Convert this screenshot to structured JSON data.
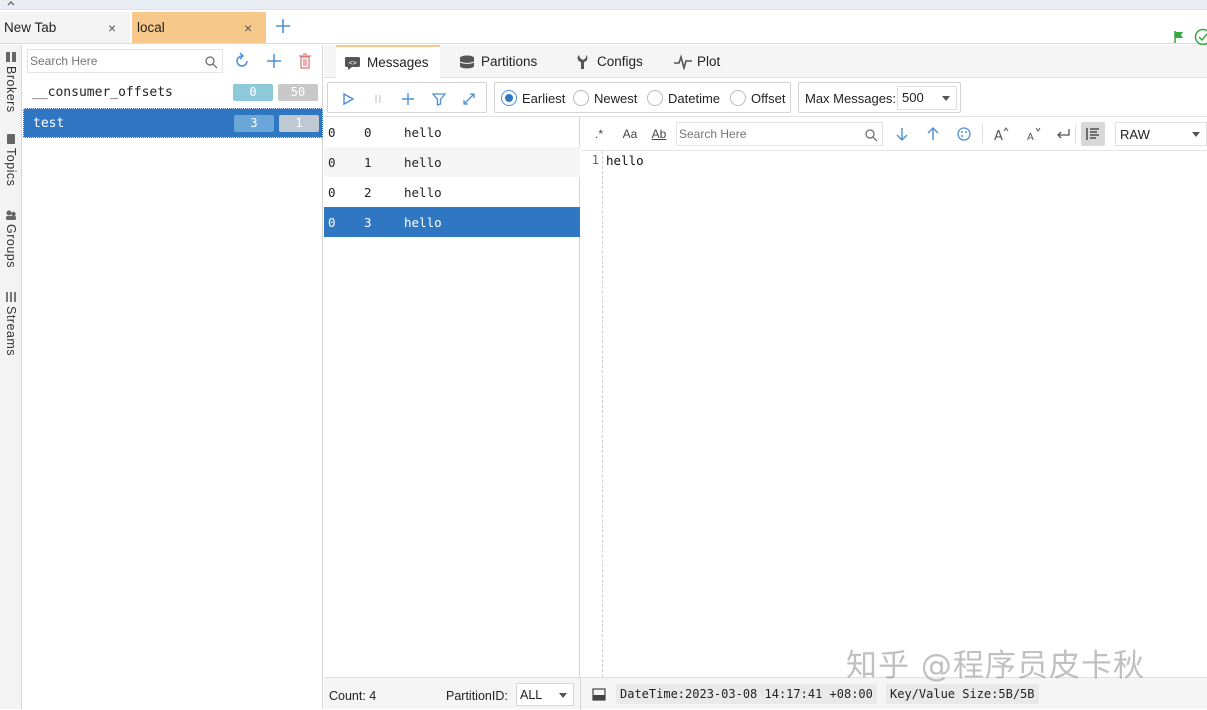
{
  "window_tabs": [
    {
      "label": "New Tab",
      "close": "×"
    },
    {
      "label": "local",
      "close": "×"
    }
  ],
  "tab_add": "+",
  "rail": {
    "items": [
      {
        "label": "Brokers"
      },
      {
        "label": "Topics"
      },
      {
        "label": "Groups"
      },
      {
        "label": "Streams"
      }
    ]
  },
  "topics": {
    "search_placeholder": "Search Here",
    "rows": [
      {
        "name": "__consumer_offsets",
        "partitions": "0",
        "replicas": "50"
      },
      {
        "name": "test",
        "partitions": "3",
        "replicas": "1"
      }
    ]
  },
  "main_tabs": [
    {
      "label": "Messages"
    },
    {
      "label": "Partitions"
    },
    {
      "label": "Configs"
    },
    {
      "label": "Plot"
    }
  ],
  "toolbar": {
    "radios": [
      {
        "label": "Earliest",
        "selected": true
      },
      {
        "label": "Newest",
        "selected": false
      },
      {
        "label": "Datetime",
        "selected": false
      },
      {
        "label": "Offset",
        "selected": false
      }
    ],
    "max_messages_label": "Max Messages:",
    "max_messages_value": "500"
  },
  "messages": [
    {
      "partition": "0",
      "offset": "0",
      "value": "hello"
    },
    {
      "partition": "0",
      "offset": "1",
      "value": "hello"
    },
    {
      "partition": "0",
      "offset": "2",
      "value": "hello"
    },
    {
      "partition": "0",
      "offset": "3",
      "value": "hello"
    }
  ],
  "editor": {
    "search_placeholder": "Search Here",
    "format": "RAW",
    "line_number": "1",
    "content": "hello",
    "regex_glyph": ".*",
    "case_glyph": "Aa",
    "word_glyph": "Ab"
  },
  "status": {
    "count": "Count: 4",
    "partition_label": "PartitionID:",
    "partition_value": "ALL",
    "datetime": "DateTime:2023-03-08 14:17:41 +08:00",
    "size": "Key/Value Size:5B/5B"
  },
  "watermark": "知乎 @程序员皮卡秋",
  "colors": {
    "selection": "#2f77c2",
    "active_tab": "#f6c98a",
    "accent_icon": "#4a90d9",
    "ok_green": "#3aa845"
  }
}
